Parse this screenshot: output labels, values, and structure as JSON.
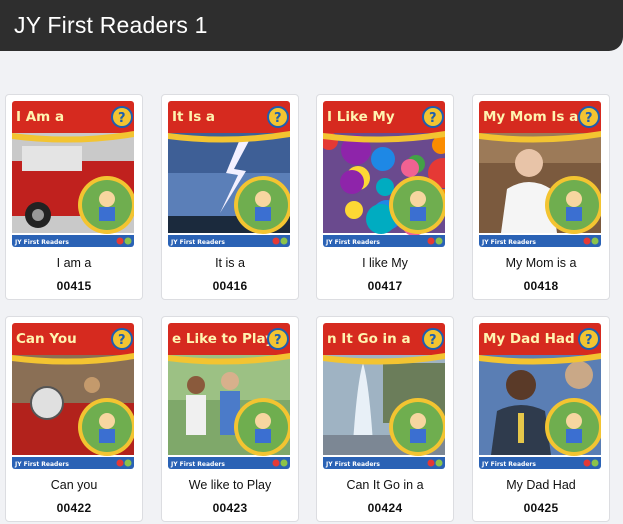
{
  "header": {
    "title": "JY First Readers 1"
  },
  "books": [
    {
      "cover_title": "I Am a",
      "series_label": "JY First Readers",
      "name": "I am a",
      "code": "00415",
      "scene": "fire-truck"
    },
    {
      "cover_title": "It Is a",
      "series_label": "JY First Readers",
      "name": "It is a",
      "code": "00416",
      "scene": "lightning"
    },
    {
      "cover_title": "I Like My",
      "series_label": "JY First Readers",
      "name": "I like My",
      "code": "00417",
      "scene": "toys"
    },
    {
      "cover_title": "My Mom Is a",
      "series_label": "JY First Readers",
      "name": "My Mom is a",
      "code": "00418",
      "scene": "chef"
    },
    {
      "cover_title": "Can You",
      "series_label": "JY First Readers",
      "name": "Can you",
      "code": "00422",
      "scene": "band"
    },
    {
      "cover_title": "e Like to Play",
      "series_label": "JY First Readers",
      "name": "We like to Play",
      "code": "00423",
      "scene": "children"
    },
    {
      "cover_title": "n It Go in a",
      "series_label": "JY First Readers",
      "name": "Can It Go in a",
      "code": "00424",
      "scene": "fountain"
    },
    {
      "cover_title": "My Dad Had",
      "series_label": "JY First Readers",
      "name": "My Dad Had",
      "code": "00425",
      "scene": "dad"
    }
  ]
}
